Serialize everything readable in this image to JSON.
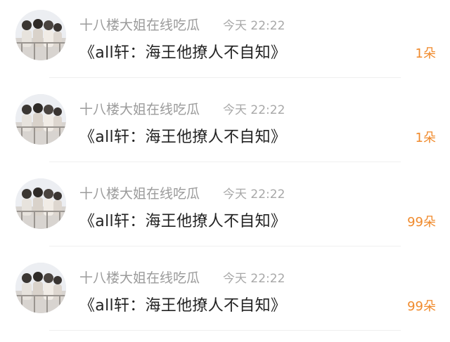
{
  "messages": [
    {
      "username": "十八楼大姐在线吃瓜",
      "time": "今天 22:22",
      "text": "《all轩：海王他撩人不自知》",
      "gift": "1朵"
    },
    {
      "username": "十八楼大姐在线吃瓜",
      "time": "今天 22:22",
      "text": "《all轩：海王他撩人不自知》",
      "gift": "1朵"
    },
    {
      "username": "十八楼大姐在线吃瓜",
      "time": "今天 22:22",
      "text": "《all轩：海王他撩人不自知》",
      "gift": "99朵"
    },
    {
      "username": "十八楼大姐在线吃瓜",
      "time": "今天 22:22",
      "text": "《all轩：海王他撩人不自知》",
      "gift": "99朵"
    }
  ],
  "colors": {
    "username": "#9b9b9b",
    "time": "#a8a8a8",
    "message": "#222222",
    "gift": "#f08a2c"
  },
  "icons": {
    "avatar": "group-photo-avatar"
  }
}
